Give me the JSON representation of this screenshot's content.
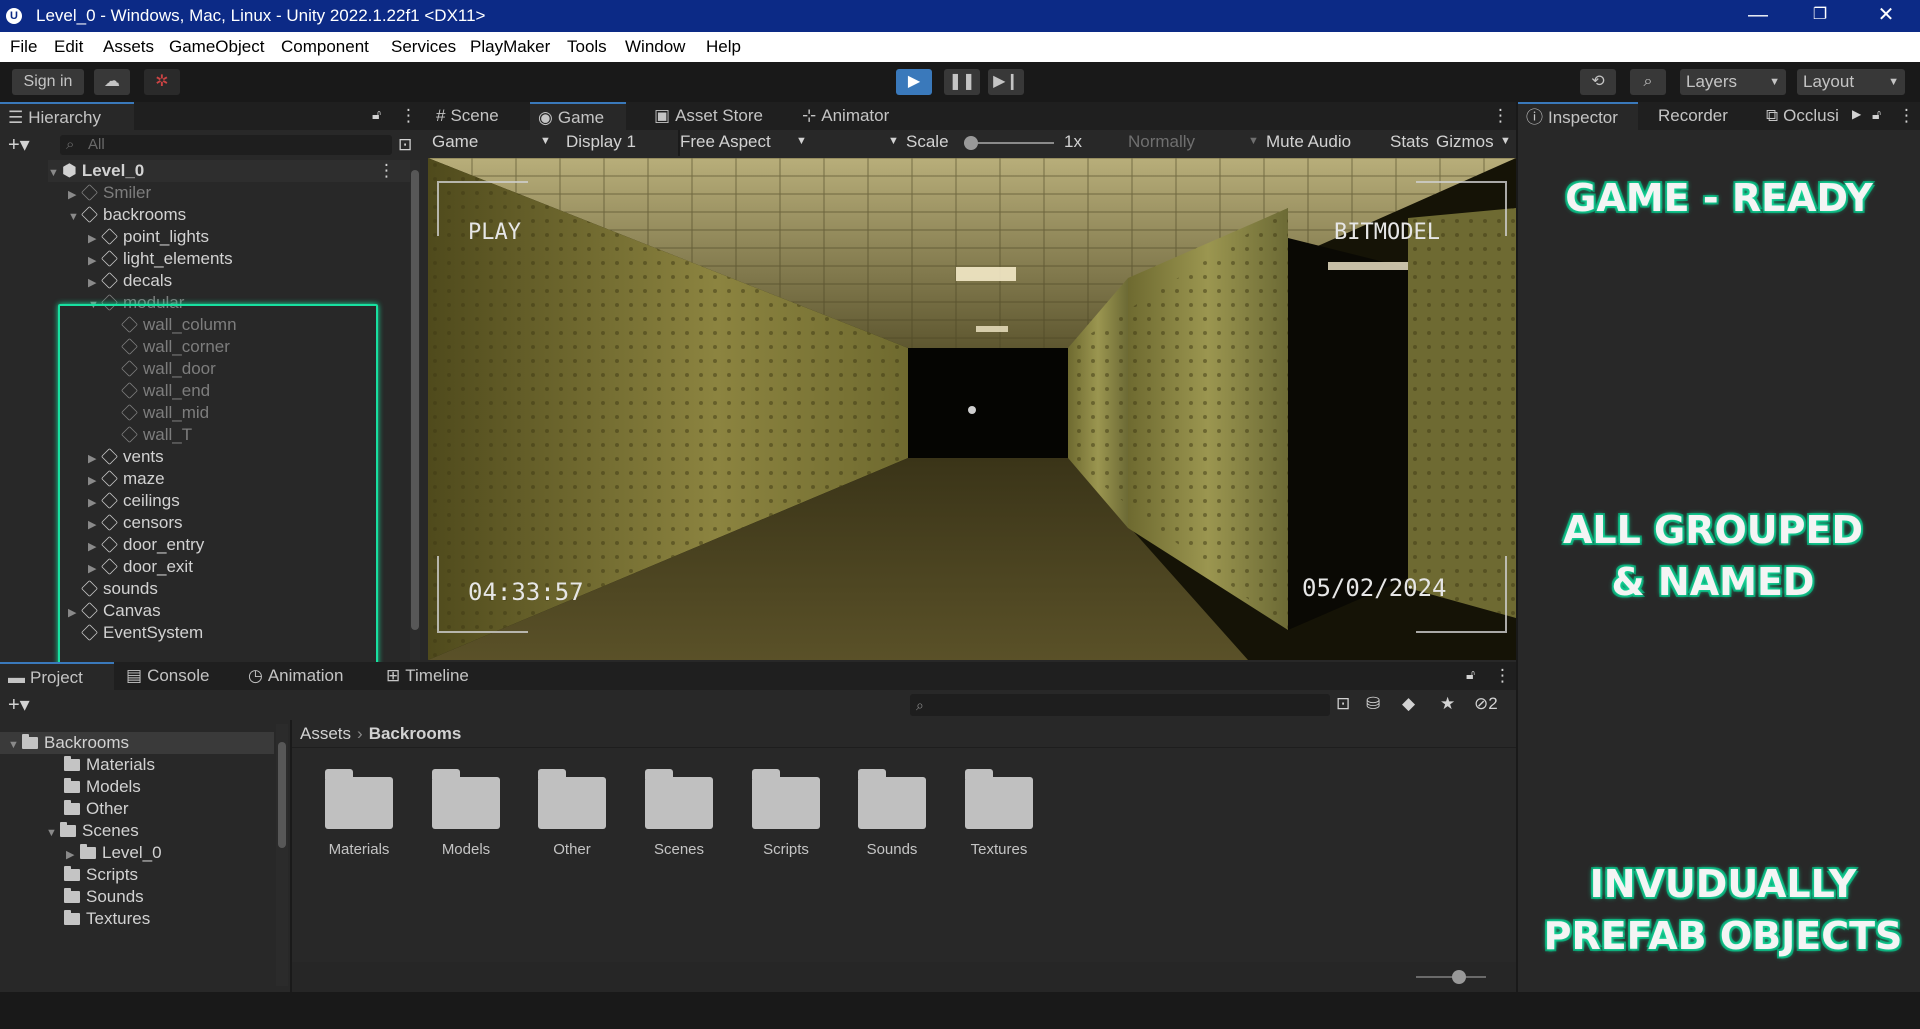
{
  "window": {
    "title": "Level_0 - Windows, Mac, Linux - Unity 2022.1.22f1 <DX11>"
  },
  "menu": [
    "File",
    "Edit",
    "Assets",
    "GameObject",
    "Component",
    "Services",
    "PlayMaker",
    "Tools",
    "Window",
    "Help"
  ],
  "toolbar": {
    "sign_in": "Sign in",
    "layers": "Layers",
    "layout": "Layout"
  },
  "hierarchy": {
    "tab": "Hierarchy",
    "search_placeholder": "All",
    "scene": "Level_0",
    "items": [
      {
        "label": "Smiler"
      },
      {
        "label": "backrooms"
      },
      {
        "label": "point_lights"
      },
      {
        "label": "light_elements"
      },
      {
        "label": "decals"
      },
      {
        "label": "modular"
      },
      {
        "label": "wall_column"
      },
      {
        "label": "wall_corner"
      },
      {
        "label": "wall_door"
      },
      {
        "label": "wall_end"
      },
      {
        "label": "wall_mid"
      },
      {
        "label": "wall_T"
      },
      {
        "label": "vents"
      },
      {
        "label": "maze"
      },
      {
        "label": "ceilings"
      },
      {
        "label": "censors"
      },
      {
        "label": "door_entry"
      },
      {
        "label": "door_exit"
      },
      {
        "label": "sounds"
      },
      {
        "label": "Canvas"
      },
      {
        "label": "EventSystem"
      }
    ]
  },
  "game_tabs": [
    "Scene",
    "Game",
    "Asset Store",
    "Animator"
  ],
  "game_toolbar": {
    "mode": "Game",
    "display": "Display 1",
    "aspect": "Free Aspect",
    "scale_label": "Scale",
    "scale_value": "1x",
    "normally": "Normally",
    "mute": "Mute Audio",
    "stats": "Stats",
    "gizmos": "Gizmos"
  },
  "viewport": {
    "play": "PLAY",
    "brand": "BITMODEL",
    "time": "04:33:57",
    "date": "05/02/2024"
  },
  "inspector": {
    "tabs": [
      "Inspector",
      "Recorder",
      "Occlusi"
    ],
    "overlay_1": "GAME - READY",
    "overlay_2a": "ALL GROUPED",
    "overlay_2b": "& NAMED",
    "overlay_3a": "INVUDUALLY",
    "overlay_3b": "PREFAB OBJECTS"
  },
  "bottom_tabs": [
    "Project",
    "Console",
    "Animation",
    "Timeline"
  ],
  "project": {
    "tree": [
      {
        "label": "Backrooms"
      },
      {
        "label": "Materials"
      },
      {
        "label": "Models"
      },
      {
        "label": "Other"
      },
      {
        "label": "Scenes"
      },
      {
        "label": "Level_0"
      },
      {
        "label": "Scripts"
      },
      {
        "label": "Sounds"
      },
      {
        "label": "Textures"
      }
    ],
    "breadcrumb": {
      "root": "Assets",
      "current": "Backrooms"
    },
    "folders": [
      "Materials",
      "Models",
      "Other",
      "Scenes",
      "Scripts",
      "Sounds",
      "Textures"
    ],
    "hidden_count": "2"
  },
  "colors": {
    "accent": "#3a79bb",
    "highlight": "#18e0a0",
    "titlebar": "#0c2a86"
  }
}
